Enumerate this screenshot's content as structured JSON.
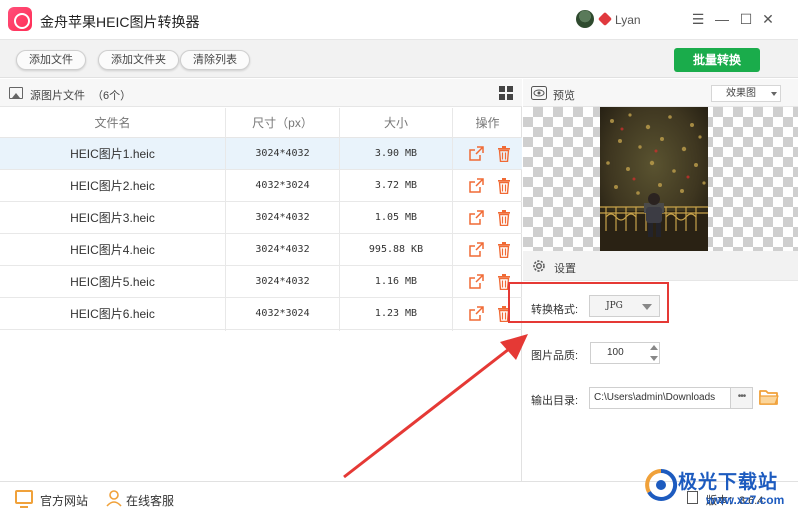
{
  "app": {
    "title": "金舟苹果HEIC图片转换器",
    "user_name": "Lyan",
    "window_controls": [
      "menu-icon",
      "minimize-icon",
      "maximize-icon",
      "close-icon"
    ]
  },
  "toolbar": {
    "add_file": "添加文件",
    "add_folder": "添加文件夹",
    "clear_list": "清除列表",
    "batch_convert": "批量转换"
  },
  "file_panel": {
    "title": "源图片文件",
    "count": "（6个）",
    "columns": [
      "文件名",
      "尺寸（px）",
      "大小",
      "操作"
    ],
    "rows": [
      {
        "name": "HEIC图片1.heic",
        "dimensions": "3024*4032",
        "size": "3.90 MB"
      },
      {
        "name": "HEIC图片2.heic",
        "dimensions": "4032*3024",
        "size": "3.72 MB"
      },
      {
        "name": "HEIC图片3.heic",
        "dimensions": "3024*4032",
        "size": "1.05 MB"
      },
      {
        "name": "HEIC图片4.heic",
        "dimensions": "3024*4032",
        "size": "995.88 KB"
      },
      {
        "name": "HEIC图片5.heic",
        "dimensions": "3024*4032",
        "size": "1.16 MB"
      },
      {
        "name": "HEIC图片6.heic",
        "dimensions": "4032*3024",
        "size": "1.23 MB"
      }
    ]
  },
  "preview": {
    "title": "预览",
    "mode": "效果图"
  },
  "settings": {
    "title": "设置",
    "format_label": "转换格式:",
    "format_value": "JPG",
    "quality_label": "图片品质:",
    "quality_value": "100",
    "output_label": "输出目录:",
    "output_value": "C:\\Users\\admin\\Downloads",
    "more_label": "•••"
  },
  "footer": {
    "website": "官方网站",
    "support": "在线客服",
    "version": "版本：3.6.4"
  },
  "watermark": {
    "title": "极光下载站",
    "url": "www.xz7.com"
  },
  "colors": {
    "accent_green": "#1aac4b",
    "action_orange": "#f06a35",
    "highlight_red": "#e53935",
    "selected_row": "#e9f3fb",
    "watermark_blue": "#1d5bbf"
  }
}
